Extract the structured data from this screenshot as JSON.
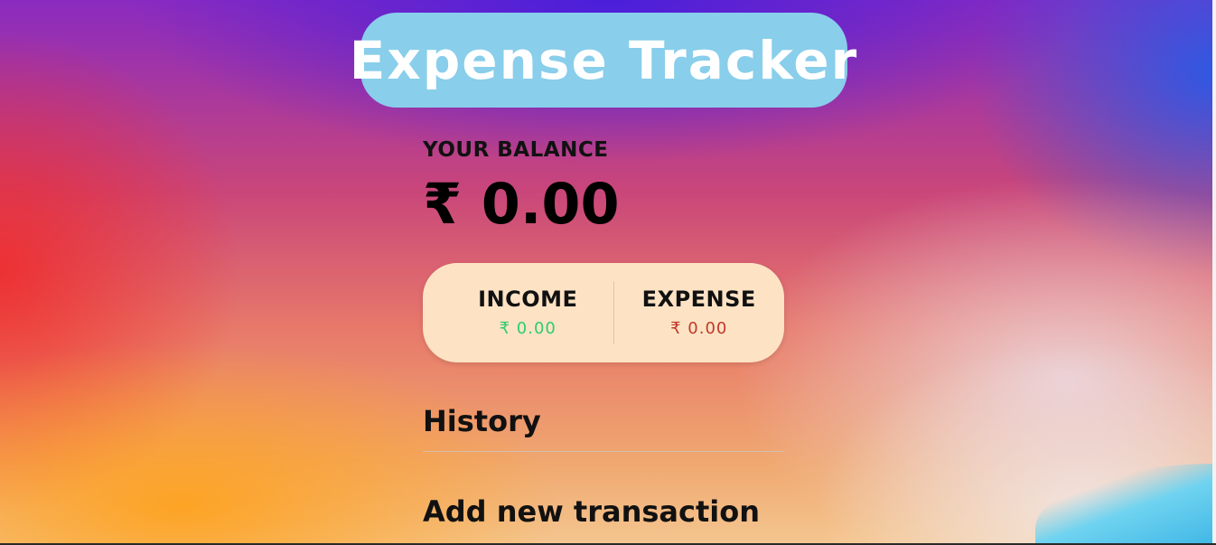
{
  "app": {
    "title": "Expense Tracker"
  },
  "balance": {
    "label": "YOUR BALANCE",
    "amount": "₹ 0.00"
  },
  "income": {
    "label": "INCOME",
    "amount": "₹ 0.00",
    "color": "#2ecc71"
  },
  "expense": {
    "label": "EXPENSE",
    "amount": "₹ 0.00",
    "color": "#c0392b"
  },
  "history": {
    "heading": "History"
  },
  "add_transaction": {
    "heading": "Add new transaction"
  },
  "colors": {
    "title_pill": "#89ceeb",
    "card_bg": "#fde3c4"
  }
}
